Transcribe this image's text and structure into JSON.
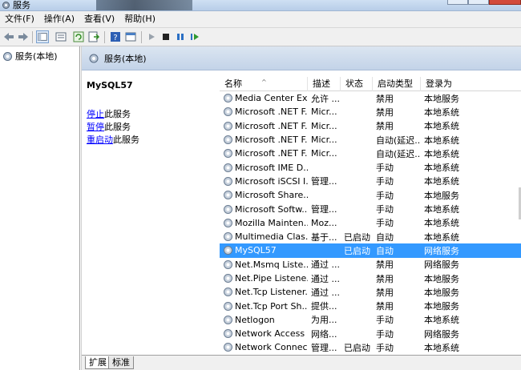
{
  "window": {
    "title": "服务"
  },
  "menu": {
    "items": [
      "文件(F)",
      "操作(A)",
      "查看(V)",
      "帮助(H)"
    ]
  },
  "tree": {
    "root_label": "服务(本地)"
  },
  "pane": {
    "header": "服务(本地)"
  },
  "info": {
    "service_name": "MySQL57",
    "actions": [
      {
        "link": "停止",
        "rest": "此服务"
      },
      {
        "link": "暂停",
        "rest": "此服务"
      },
      {
        "link": "重启动",
        "rest": "此服务"
      }
    ]
  },
  "columns": [
    "名称",
    "描述",
    "状态",
    "启动类型",
    "登录为"
  ],
  "rows": [
    {
      "name": "Media Center Ex...",
      "desc": "允许 ...",
      "status": "",
      "start": "禁用",
      "logon": "本地服务"
    },
    {
      "name": "Microsoft .NET F...",
      "desc": "Micr...",
      "status": "",
      "start": "禁用",
      "logon": "本地系统"
    },
    {
      "name": "Microsoft .NET F...",
      "desc": "Micr...",
      "status": "",
      "start": "禁用",
      "logon": "本地系统"
    },
    {
      "name": "Microsoft .NET F...",
      "desc": "Micr...",
      "status": "",
      "start": "自动(延迟...",
      "logon": "本地系统"
    },
    {
      "name": "Microsoft .NET F...",
      "desc": "Micr...",
      "status": "",
      "start": "自动(延迟...",
      "logon": "本地系统"
    },
    {
      "name": "Microsoft IME D...",
      "desc": "",
      "status": "",
      "start": "手动",
      "logon": "本地系统"
    },
    {
      "name": "Microsoft iSCSI I...",
      "desc": "管理...",
      "status": "",
      "start": "手动",
      "logon": "本地系统"
    },
    {
      "name": "Microsoft Share...",
      "desc": "",
      "status": "",
      "start": "手动",
      "logon": "本地服务"
    },
    {
      "name": "Microsoft Softw...",
      "desc": "管理...",
      "status": "",
      "start": "手动",
      "logon": "本地系统"
    },
    {
      "name": "Mozilla Mainten...",
      "desc": "Moz...",
      "status": "",
      "start": "手动",
      "logon": "本地系统"
    },
    {
      "name": "Multimedia Clas...",
      "desc": "基于...",
      "status": "已启动",
      "start": "自动",
      "logon": "本地系统"
    },
    {
      "name": "MySQL57",
      "desc": "",
      "status": "已启动",
      "start": "自动",
      "logon": "网络服务",
      "selected": true
    },
    {
      "name": "Net.Msmq Liste...",
      "desc": "通过 ...",
      "status": "",
      "start": "禁用",
      "logon": "网络服务"
    },
    {
      "name": "Net.Pipe Listene...",
      "desc": "通过 ...",
      "status": "",
      "start": "禁用",
      "logon": "本地服务"
    },
    {
      "name": "Net.Tcp Listener...",
      "desc": "通过 ...",
      "status": "",
      "start": "禁用",
      "logon": "本地服务"
    },
    {
      "name": "Net.Tcp Port Sh...",
      "desc": "提供...",
      "status": "",
      "start": "禁用",
      "logon": "本地服务"
    },
    {
      "name": "Netlogon",
      "desc": "为用...",
      "status": "",
      "start": "手动",
      "logon": "本地系统"
    },
    {
      "name": "Network Access ...",
      "desc": "网络...",
      "status": "",
      "start": "手动",
      "logon": "网络服务"
    },
    {
      "name": "Network Connec...",
      "desc": "管理...",
      "status": "已启动",
      "start": "手动",
      "logon": "本地系统"
    }
  ],
  "tabs": [
    "扩展",
    "标准"
  ],
  "colors": {
    "selection": "#3399ff",
    "link": "#0000ff",
    "header_gradient_top": "#dbe5f1"
  }
}
